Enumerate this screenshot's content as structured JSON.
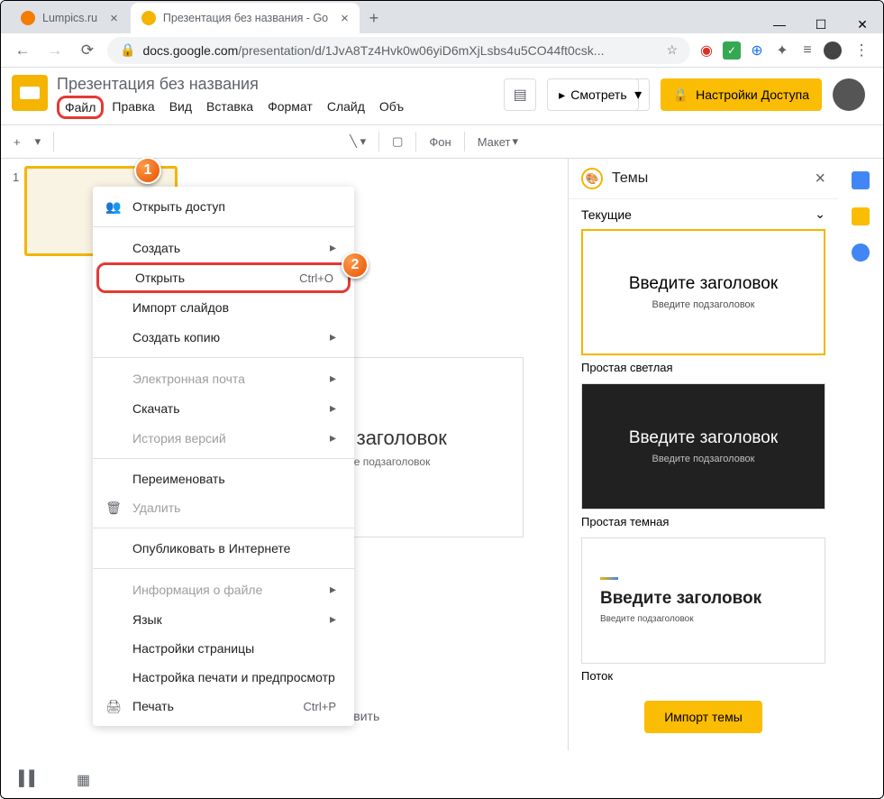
{
  "window": {
    "minimize": "—",
    "maximize": "☐",
    "close": "✕"
  },
  "tabs": [
    {
      "title": "Lumpics.ru",
      "favicon": "#f57c00"
    },
    {
      "title": "Презентация без названия - Go",
      "favicon": "#f4b400"
    }
  ],
  "address": {
    "lock": "🔒",
    "domain": "docs.google.com",
    "path": "/presentation/d/1JvA8Tz4Hvk0w06yiD6mXjLsbs4u5CO44ft0csk...",
    "star": "☆"
  },
  "extensions": [
    "🛡",
    "✅",
    "🌐",
    "✦",
    "≡"
  ],
  "doc": {
    "title": "Презентация без названия"
  },
  "menubar": [
    "Файл",
    "Правка",
    "Вид",
    "Вставка",
    "Формат",
    "Слайд",
    "Объ"
  ],
  "header_buttons": {
    "watch": "Смотреть",
    "share": "Настройки Доступа"
  },
  "toolbar": {
    "add": "+",
    "bg": "Фон",
    "layout": "Макет"
  },
  "dropdown": [
    {
      "label": "Открыть доступ",
      "icon": "👥"
    },
    {
      "sep": true
    },
    {
      "label": "Создать",
      "sub": true
    },
    {
      "label": "Открыть",
      "shortcut": "Ctrl+O",
      "hl": true
    },
    {
      "label": "Импорт слайдов"
    },
    {
      "label": "Создать копию",
      "sub": true
    },
    {
      "sep": true
    },
    {
      "label": "Электронная почта",
      "sub": true,
      "disabled": true
    },
    {
      "label": "Скачать",
      "sub": true
    },
    {
      "label": "История версий",
      "sub": true,
      "disabled": true
    },
    {
      "sep": true
    },
    {
      "label": "Переименовать"
    },
    {
      "label": "Удалить",
      "icon": "🗑",
      "disabled": true
    },
    {
      "sep": true
    },
    {
      "label": "Опубликовать в Интернете"
    },
    {
      "sep": true
    },
    {
      "label": "Информация о файле",
      "sub": true,
      "disabled": true
    },
    {
      "label": "Язык",
      "sub": true
    },
    {
      "label": "Настройки страницы"
    },
    {
      "label": "Настройка печати и предпросмотр"
    },
    {
      "label": "Печать",
      "icon": "🖨",
      "shortcut": "Ctrl+P"
    }
  ],
  "themes": {
    "title": "Темы",
    "current": "Текущие",
    "cards": [
      {
        "title": "Введите заголовок",
        "sub": "Введите подзаголовок",
        "label": "Простая светлая",
        "selected": true
      },
      {
        "title": "Введите заголовок",
        "sub": "Введите подзаголовок",
        "label": "Простая темная",
        "dark": true
      },
      {
        "title": "Введите заголовок",
        "sub": "Введите подзаголовок",
        "label": "Поток",
        "stream": true
      }
    ],
    "import": "Импорт темы"
  },
  "canvas": {
    "title": "ите заголовок",
    "sub": "дите подзаголовок",
    "notes": "Нажмите, чтобы добавить"
  },
  "slide_num": "1",
  "badges": {
    "b1": "1",
    "b2": "2"
  }
}
